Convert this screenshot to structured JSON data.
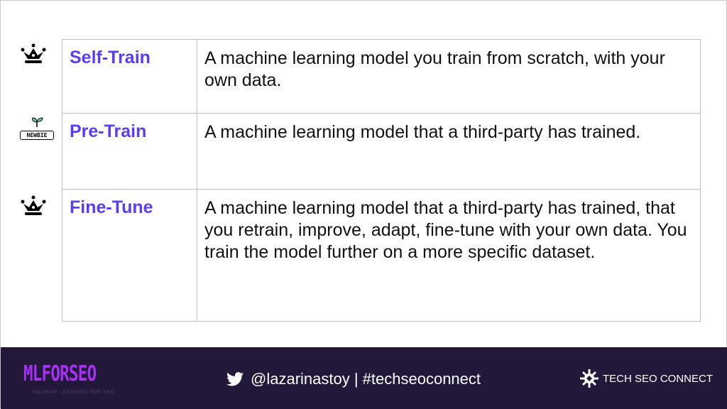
{
  "rows": [
    {
      "icon": "crown-icon",
      "term": "Self-Train",
      "definition": "A machine learning model you train from scratch, with your own data."
    },
    {
      "icon": "newbie-sprout-icon",
      "icon_text": "NEWBIE",
      "term": "Pre-Train",
      "definition": "A machine learning model that a third-party has trained."
    },
    {
      "icon": "crown-icon",
      "term": "Fine-Tune",
      "definition": "A machine learning model that a third-party has trained, that you retrain, improve, adapt, fine-tune with your own data. You train the model further on a more specific dataset."
    }
  ],
  "footer": {
    "logo": "MLFORSEO",
    "logo_subtitle": "MACHINE LEARNING FOR SEO",
    "social": "@lazarinastoy | #techseoconnect",
    "brand": "TECH SEO CONNECT"
  },
  "colors": {
    "accent": "#5b3ef2",
    "footer_bg": "#22183a",
    "logo": "#a830f5"
  }
}
